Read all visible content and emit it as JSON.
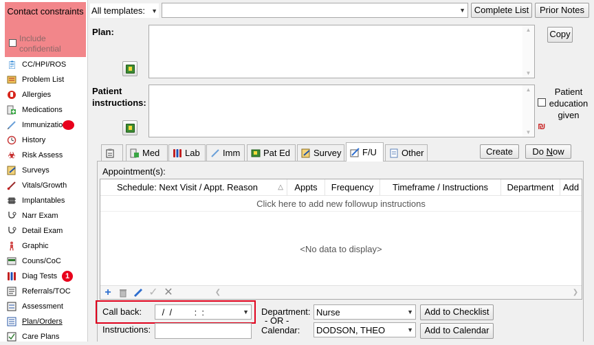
{
  "sidebar": {
    "contact_constraints": "Contact constraints",
    "include_confidential": "Include confidential",
    "items": [
      {
        "label": "CC/HPI/ROS",
        "icon": "clipboard-icon"
      },
      {
        "label": "Problem List",
        "icon": "list-icon"
      },
      {
        "label": "Allergies",
        "icon": "allergy-hand-icon"
      },
      {
        "label": "Medications",
        "icon": "medication-icon"
      },
      {
        "label": "Immunizatio",
        "icon": "syringe-icon"
      },
      {
        "label": "History",
        "icon": "history-icon"
      },
      {
        "label": "Risk Assess",
        "icon": "biohazard-icon"
      },
      {
        "label": "Surveys",
        "icon": "survey-icon"
      },
      {
        "label": "Vitals/Growth",
        "icon": "thermometer-icon"
      },
      {
        "label": "Implantables",
        "icon": "chip-icon"
      },
      {
        "label": "Narr Exam",
        "icon": "stethoscope-icon"
      },
      {
        "label": "Detail Exam",
        "icon": "stethoscope-icon"
      },
      {
        "label": "Graphic",
        "icon": "body-icon"
      },
      {
        "label": "Couns/CoC",
        "icon": "counseling-icon"
      },
      {
        "label": "Diag Tests",
        "icon": "test-tubes-icon"
      },
      {
        "label": "Referrals/TOC",
        "icon": "referral-icon"
      },
      {
        "label": "Assessment",
        "icon": "assessment-icon"
      },
      {
        "label": "Plan/Orders",
        "icon": "orders-icon"
      },
      {
        "label": "Care Plans",
        "icon": "care-plan-icon"
      }
    ],
    "diag_tests_badge": "1"
  },
  "top": {
    "template_select": "All templates:",
    "complete_list": "Complete List",
    "prior_notes": "Prior Notes"
  },
  "plan": {
    "label": "Plan:",
    "copy": "Copy"
  },
  "patient_instructions": {
    "label": "Patient instructions:",
    "education_given": "Patient education given"
  },
  "tabs": [
    {
      "label": "",
      "icon": "clipboard-icon"
    },
    {
      "label": "Med",
      "icon": "medication-icon"
    },
    {
      "label": "Lab",
      "icon": "test-tubes-icon"
    },
    {
      "label": "Imm",
      "icon": "syringe-icon"
    },
    {
      "label": "Pat Ed",
      "icon": "book-icon"
    },
    {
      "label": "Survey",
      "icon": "survey-icon"
    },
    {
      "label": "F/U",
      "icon": "notepad-icon"
    },
    {
      "label": "Other",
      "icon": "document-icon"
    }
  ],
  "actions": {
    "create": "Create",
    "do_now": "Do Now"
  },
  "appointments": {
    "label": "Appointment(s):",
    "columns": [
      "Schedule: Next Visit / Appt. Reason",
      "Appts",
      "Frequency",
      "Timeframe / Instructions",
      "Department",
      "Add"
    ],
    "add_row_hint": "Click here to add new followup instructions",
    "empty_text": "<No data to display>"
  },
  "followup": {
    "call_back_label": "Call back:",
    "call_back_value": " /  /         :  :",
    "instructions_label": "Instructions:",
    "instructions_value": "",
    "department_label": "Department:",
    "or_label": "- OR -",
    "calendar_label": "Calendar:",
    "department_value": "Nurse",
    "calendar_value": "DODSON, THEO",
    "add_to_checklist": "Add to Checklist",
    "add_to_calendar": "Add to Calendar"
  },
  "colors": {
    "contact_bg": "#f2868a",
    "badge_red": "#e8001c",
    "highlight_box": "#e0001b"
  }
}
